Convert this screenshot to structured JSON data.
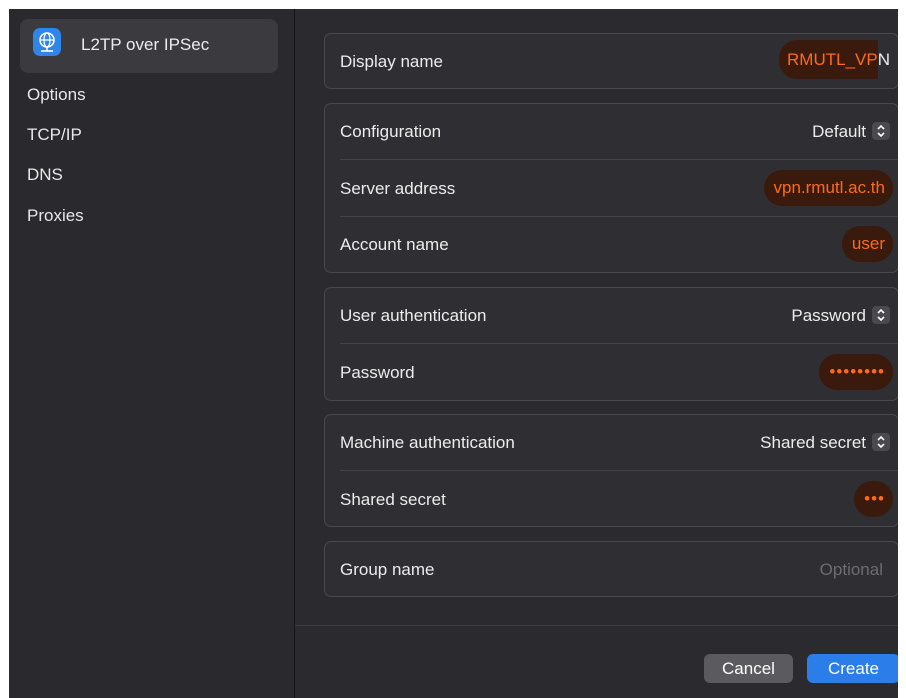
{
  "sidebar": {
    "selected": {
      "label": "L2TP over IPSec",
      "icon": "vpn-globe-icon"
    },
    "items": [
      {
        "label": "Options"
      },
      {
        "label": "TCP/IP"
      },
      {
        "label": "DNS"
      },
      {
        "label": "Proxies"
      }
    ]
  },
  "form": {
    "display_name": {
      "label": "Display name",
      "value_highlight": "RMUTL_VP",
      "value_rest": "N"
    },
    "configuration": {
      "label": "Configuration",
      "value": "Default"
    },
    "server_address": {
      "label": "Server address",
      "value": "vpn.rmutl.ac.th"
    },
    "account_name": {
      "label": "Account name",
      "value": "user"
    },
    "user_authentication": {
      "label": "User authentication",
      "value": "Password"
    },
    "password": {
      "label": "Password",
      "value": "••••••••"
    },
    "machine_authentication": {
      "label": "Machine authentication",
      "value": "Shared secret"
    },
    "shared_secret": {
      "label": "Shared secret",
      "value": "•••"
    },
    "group_name": {
      "label": "Group name",
      "placeholder": "Optional"
    }
  },
  "buttons": {
    "cancel": "Cancel",
    "create": "Create"
  },
  "colors": {
    "accent": "#2b7de9",
    "highlight_text": "#ff6a1a",
    "highlight_bg": "#3a1a0c",
    "window_bg": "#2b2a2e"
  }
}
